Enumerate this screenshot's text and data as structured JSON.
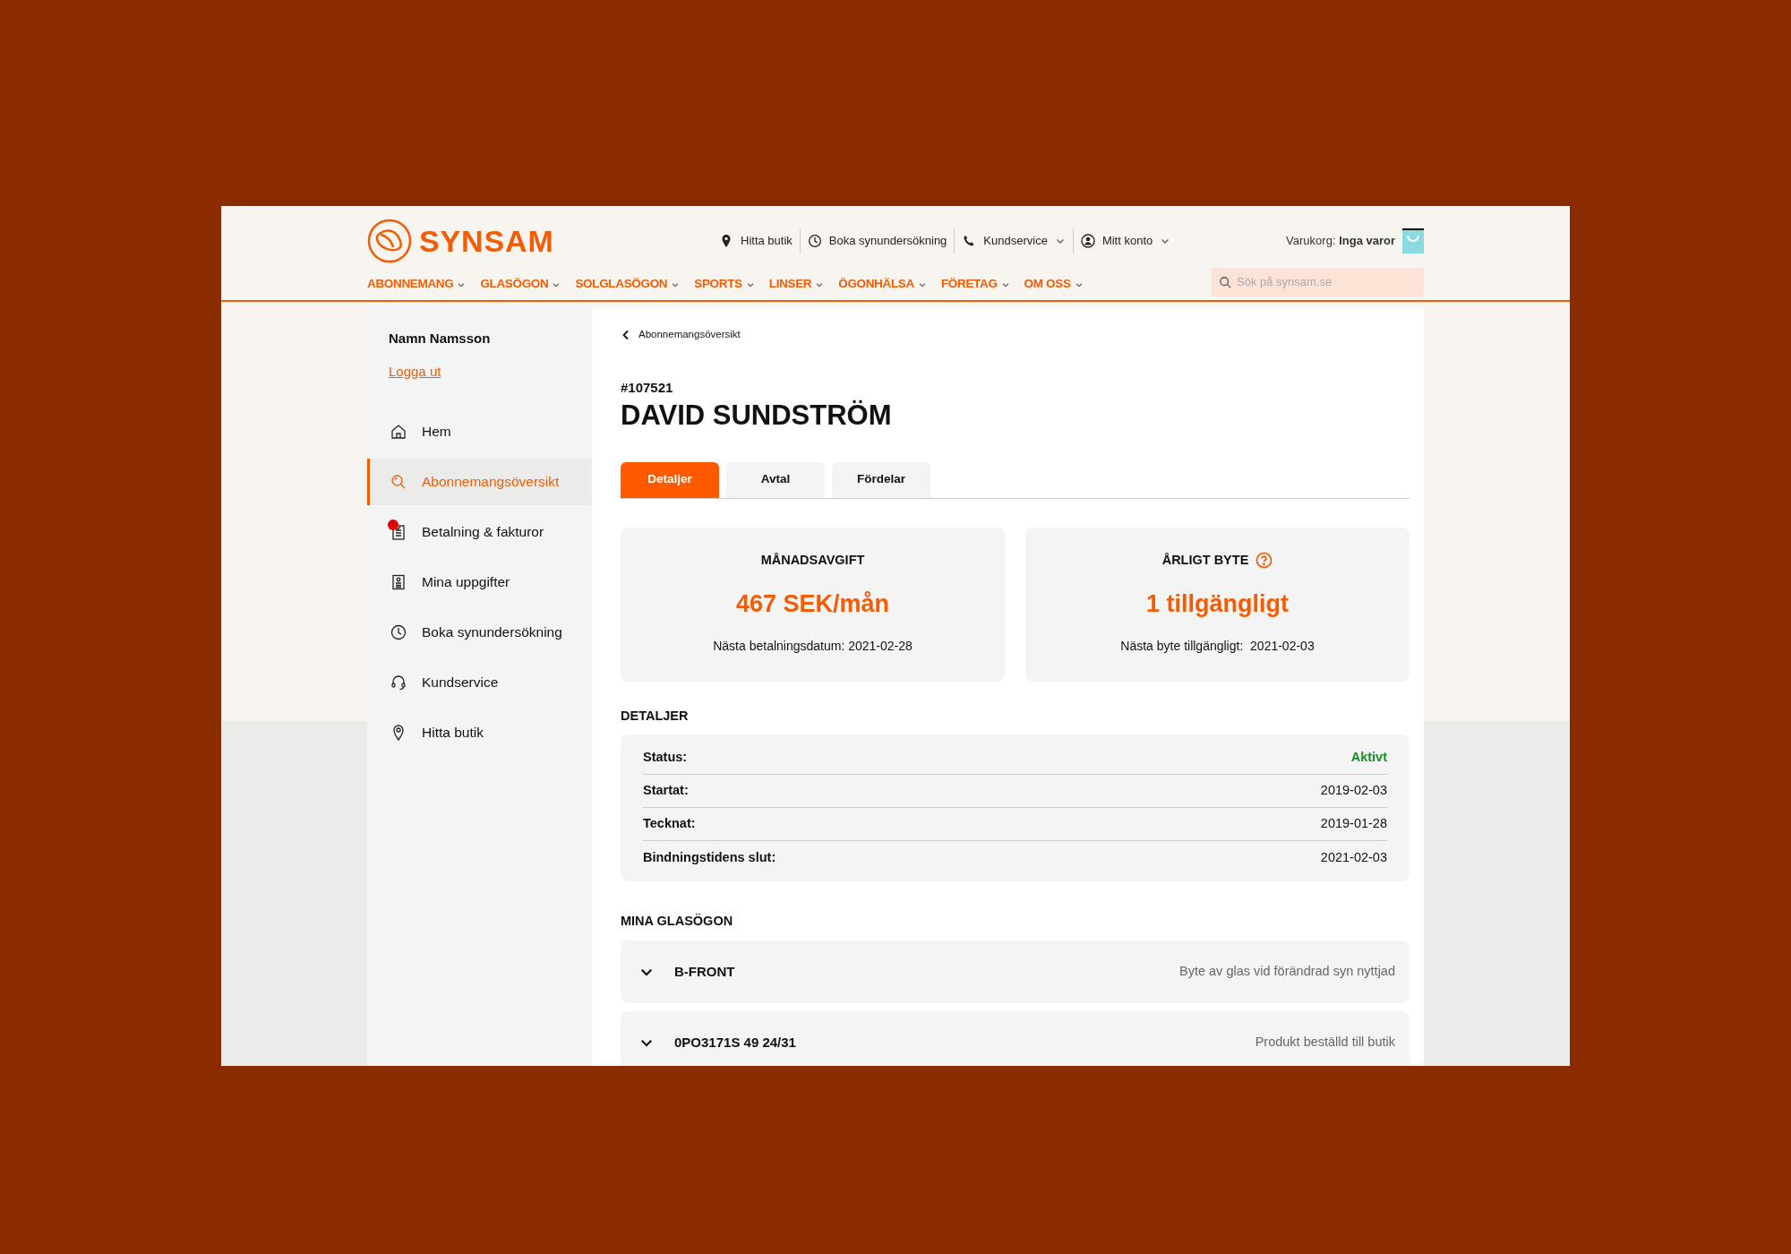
{
  "header": {
    "logo_text": "SYNSAM",
    "top_links": [
      {
        "label": "Hitta butik",
        "dropdown": false
      },
      {
        "label": "Boka synundersökning",
        "dropdown": false
      },
      {
        "label": "Kundservice",
        "dropdown": true
      },
      {
        "label": "Mitt konto",
        "dropdown": true
      }
    ],
    "cart": {
      "label": "Varukorg:",
      "value": "Inga varor"
    },
    "nav": [
      "ABONNEMANG",
      "GLASÖGON",
      "SOLGLASÖGON",
      "SPORTS",
      "LINSER",
      "ÖGONHÄLSA",
      "FÖRETAG",
      "OM OSS"
    ],
    "search": {
      "placeholder": "Sök på synsam.se"
    }
  },
  "sidebar": {
    "user_name": "Namn Namsson",
    "logout": "Logga ut",
    "items": [
      {
        "label": "Hem",
        "selected": false,
        "notification": false
      },
      {
        "label": "Abonnemangsöversikt",
        "selected": true,
        "notification": false
      },
      {
        "label": "Betalning & fakturor",
        "selected": false,
        "notification": true
      },
      {
        "label": "Mina uppgifter",
        "selected": false,
        "notification": false
      },
      {
        "label": "Boka synundersökning",
        "selected": false,
        "notification": false
      },
      {
        "label": "Kundservice",
        "selected": false,
        "notification": false
      },
      {
        "label": "Hitta butik",
        "selected": false,
        "notification": false
      }
    ]
  },
  "main": {
    "back_link": "Abonnemangsöversikt",
    "number": "#107521",
    "title": "DAVID SUNDSTRÖM",
    "tabs": [
      {
        "label": "Detaljer",
        "selected": true
      },
      {
        "label": "Avtal",
        "selected": false
      },
      {
        "label": "Fördelar",
        "selected": false
      }
    ],
    "cards": [
      {
        "title": "MÅNADSAVGIFT",
        "value": "467 SEK/mån",
        "note": "Nästa betalningsdatum: 2021-02-28",
        "help": false
      },
      {
        "title": "ÅRLIGT BYTE",
        "value": "1 tillgängligt",
        "note": "Nästa byte tillgängligt:  2021-02-03",
        "help": true
      }
    ],
    "details_heading": "DETALJER",
    "details": [
      {
        "label": "Status:",
        "value": "Aktivt",
        "kind": "status"
      },
      {
        "label": "Startat:",
        "value": "2019-02-03",
        "kind": "date"
      },
      {
        "label": "Tecknat:",
        "value": "2019-01-28",
        "kind": "date"
      },
      {
        "label": "Bindningstidens slut:",
        "value": "2021-02-03",
        "kind": "date"
      }
    ],
    "glasses_heading": "MINA GLASÖGON",
    "glasses": [
      {
        "name": "B-FRONT",
        "note": "Byte av glas vid förändrad syn nyttjad",
        "expanded": false
      },
      {
        "name": "0PO3171S 49 24/31",
        "note": "Produkt beställd till butik",
        "expanded": false
      }
    ]
  }
}
